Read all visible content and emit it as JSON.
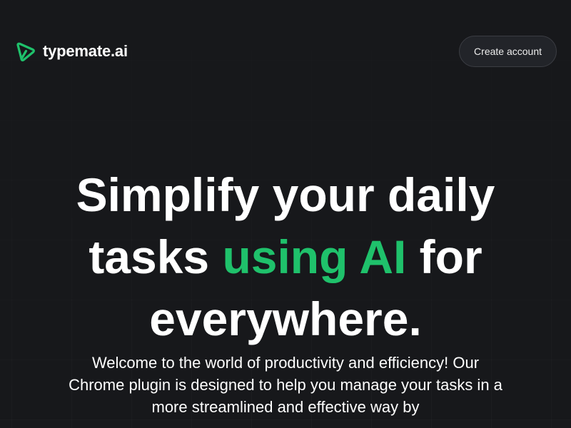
{
  "brand": {
    "name": "typemate.ai",
    "accent_color": "#1fc16b",
    "logo_icon": "typemate-logo-icon"
  },
  "nav": {
    "create_account_label": "Create account"
  },
  "hero": {
    "headline_part1": "Simplify your daily tasks ",
    "headline_accent": "using AI",
    "headline_part2": " for everywhere.",
    "subtext": "Welcome to the world of productivity and efficiency! Our Chrome plugin is designed to help you manage your tasks in a more streamlined and effective way by"
  }
}
